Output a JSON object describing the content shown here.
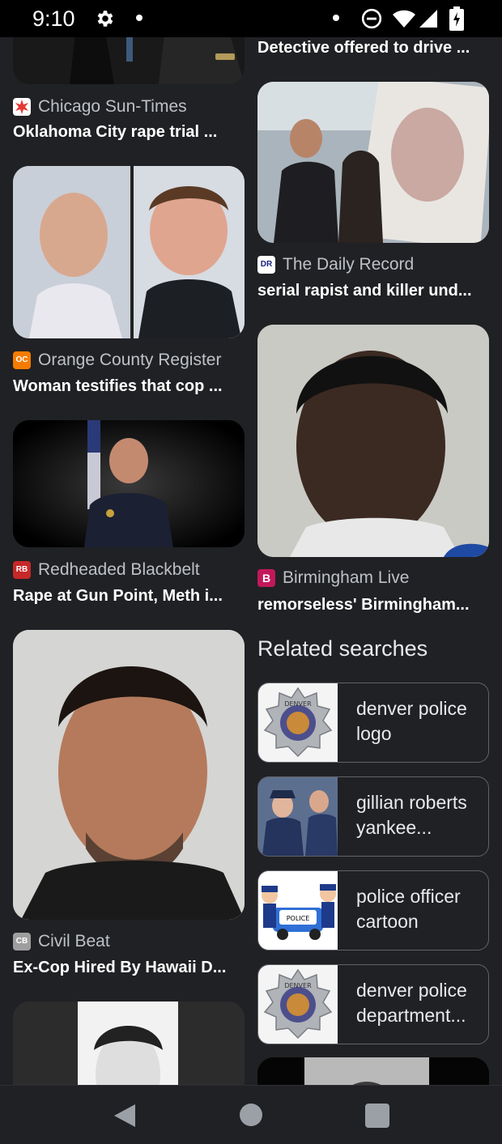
{
  "status_bar": {
    "time": "9:10"
  },
  "left_column": [
    {
      "source": "Chicago Sun-Times",
      "headline": "Oklahoma City rape trial ...",
      "favicon_color": "#e53935",
      "favicon_text": ""
    },
    {
      "source": "Orange County Register",
      "headline": "Woman testifies that cop ...",
      "favicon_color": "#f57c00",
      "favicon_text": "OC"
    },
    {
      "source": "Redheaded Blackbelt",
      "headline": "Rape at Gun Point, Meth i...",
      "favicon_color": "#c62828",
      "favicon_text": "RB"
    },
    {
      "source": "Civil Beat",
      "headline": "Ex-Cop Hired By Hawaii D...",
      "favicon_color": "#9e9e9e",
      "favicon_text": "CB"
    }
  ],
  "right_column": [
    {
      "headline": "Detective offered to drive ..."
    },
    {
      "source": "The Daily Record",
      "headline": "serial rapist and killer und...",
      "favicon_color": "#ffffff",
      "favicon_text": "DR"
    },
    {
      "source": "Birmingham Live",
      "headline": "remorseless' Birmingham...",
      "favicon_color": "#c2185b",
      "favicon_text": "B"
    }
  ],
  "related": {
    "title": "Related searches",
    "items": [
      {
        "label": "denver police logo"
      },
      {
        "label": "gillian roberts yankee..."
      },
      {
        "label": "police officer cartoon"
      },
      {
        "label": "denver police department..."
      }
    ]
  },
  "chip_text": {
    "police_badge": "POLICE",
    "car_label": "POLICE",
    "denver": "DENVER"
  }
}
